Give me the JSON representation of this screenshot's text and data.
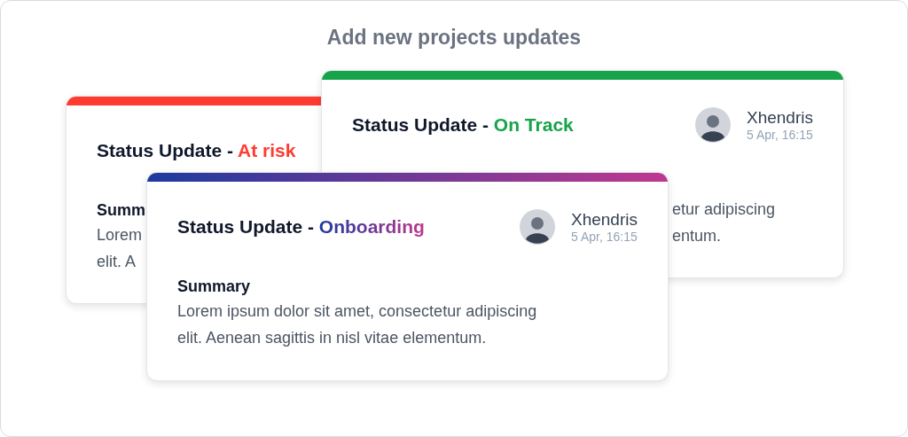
{
  "title": "Add new projects updates",
  "cards": [
    {
      "title_prefix": "Status Update - ",
      "status": "At risk",
      "color": "#ff3b30",
      "summary_label": "Summ",
      "summary_lines": [
        "Lorem",
        "elit. A"
      ]
    },
    {
      "title_prefix": "Status Update - ",
      "status": "On Track",
      "color": "#16a34a",
      "author": {
        "name": "Xhendris",
        "time": "5 Apr, 16:15"
      },
      "summary_lines": [
        "etur adipiscing",
        "entum."
      ]
    },
    {
      "title_prefix": "Status Update - ",
      "status": "Onboarding",
      "color": "#1e3a9f",
      "kind": "gradient",
      "author": {
        "name": "Xhendris",
        "time": "5 Apr, 16:15"
      },
      "summary_label": "Summary",
      "summary_lines": [
        "Lorem ipsum dolor sit amet, consectetur adipiscing",
        "elit. Aenean sagittis in nisl vitae elementum."
      ]
    }
  ]
}
